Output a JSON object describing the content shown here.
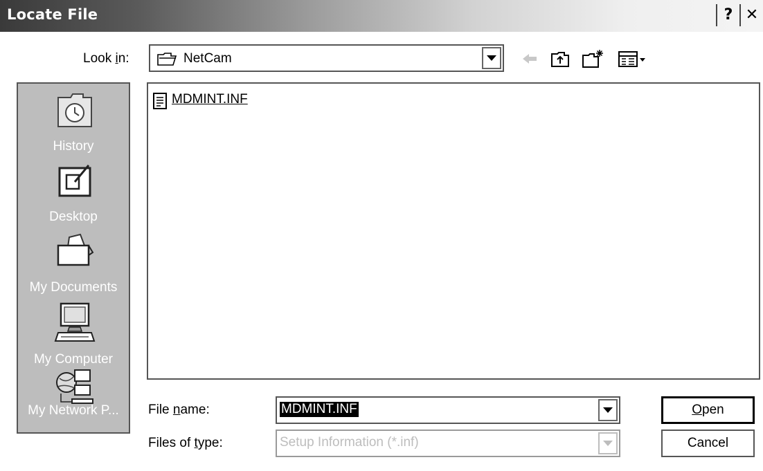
{
  "window": {
    "title": "Locate File",
    "help_label": "?",
    "close_label": "✕"
  },
  "lookin": {
    "label_pre": "Look ",
    "label_key": "i",
    "label_post": "n:",
    "value": "NetCam"
  },
  "places": [
    {
      "label": "History",
      "icon": "history-icon"
    },
    {
      "label": "Desktop",
      "icon": "desktop-icon"
    },
    {
      "label": "My Documents",
      "icon": "my-documents-icon"
    },
    {
      "label": "My Computer",
      "icon": "my-computer-icon"
    },
    {
      "label": "My Network P...",
      "icon": "network-places-icon"
    }
  ],
  "files": [
    {
      "name": "MDMINT.INF",
      "icon": "inf-file-icon"
    }
  ],
  "filename": {
    "label_pre": "File ",
    "label_key": "n",
    "label_post": "ame:",
    "value": "MDMINT.INF"
  },
  "filetype": {
    "label_pre": "Files of ",
    "label_key": "t",
    "label_post": "ype:",
    "value": "Setup Information (*.inf)"
  },
  "buttons": {
    "open_key": "O",
    "open_rest": "pen",
    "cancel": "Cancel"
  }
}
